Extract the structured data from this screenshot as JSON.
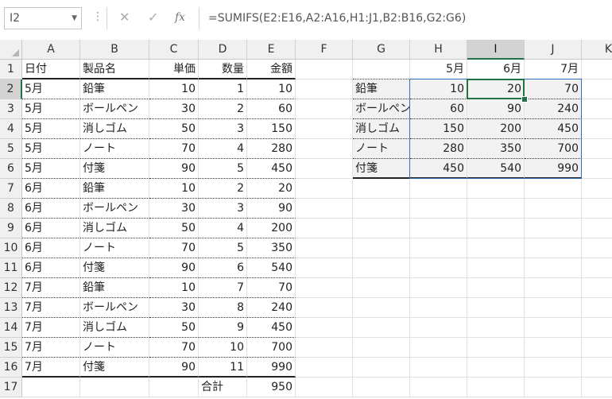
{
  "formula_bar": {
    "name_box": "I2",
    "cancel_icon": "✕",
    "enter_icon": "✓",
    "fx_label": "fx",
    "formula": "=SUMIFS(E2:E16,A2:A16,H1:J1,B2:B16,G2:G6)"
  },
  "columns": [
    "A",
    "B",
    "C",
    "D",
    "E",
    "F",
    "G",
    "H",
    "I",
    "J",
    "K"
  ],
  "selected_column": "I",
  "selected_row": "2",
  "rows": [
    "1",
    "2",
    "3",
    "4",
    "5",
    "6",
    "7",
    "8",
    "9",
    "10",
    "11",
    "12",
    "13",
    "14",
    "15",
    "16",
    "17"
  ],
  "left_table": {
    "headers": [
      "日付",
      "製品名",
      "単価",
      "数量",
      "金額"
    ],
    "data": [
      [
        "5月",
        "鉛筆",
        "10",
        "1",
        "10"
      ],
      [
        "5月",
        "ボールペン",
        "30",
        "2",
        "60"
      ],
      [
        "5月",
        "消しゴム",
        "50",
        "3",
        "150"
      ],
      [
        "5月",
        "ノート",
        "70",
        "4",
        "280"
      ],
      [
        "5月",
        "付箋",
        "90",
        "5",
        "450"
      ],
      [
        "6月",
        "鉛筆",
        "10",
        "2",
        "20"
      ],
      [
        "6月",
        "ボールペン",
        "30",
        "3",
        "90"
      ],
      [
        "6月",
        "消しゴム",
        "50",
        "4",
        "200"
      ],
      [
        "6月",
        "ノート",
        "70",
        "5",
        "350"
      ],
      [
        "6月",
        "付箋",
        "90",
        "6",
        "540"
      ],
      [
        "7月",
        "鉛筆",
        "10",
        "7",
        "70"
      ],
      [
        "7月",
        "ボールペン",
        "30",
        "8",
        "240"
      ],
      [
        "7月",
        "消しゴム",
        "50",
        "9",
        "450"
      ],
      [
        "7月",
        "ノート",
        "70",
        "10",
        "700"
      ],
      [
        "7月",
        "付箋",
        "90",
        "11",
        "990"
      ]
    ],
    "total_label": "合計",
    "total_value": "950"
  },
  "right_table": {
    "months": [
      "5月",
      "6月",
      "7月"
    ],
    "products": [
      "鉛筆",
      "ボールペン",
      "消しゴム",
      "ノート",
      "付箋"
    ],
    "values": [
      [
        "10",
        "20",
        "70"
      ],
      [
        "60",
        "90",
        "240"
      ],
      [
        "150",
        "200",
        "450"
      ],
      [
        "280",
        "350",
        "700"
      ],
      [
        "450",
        "540",
        "990"
      ]
    ]
  }
}
